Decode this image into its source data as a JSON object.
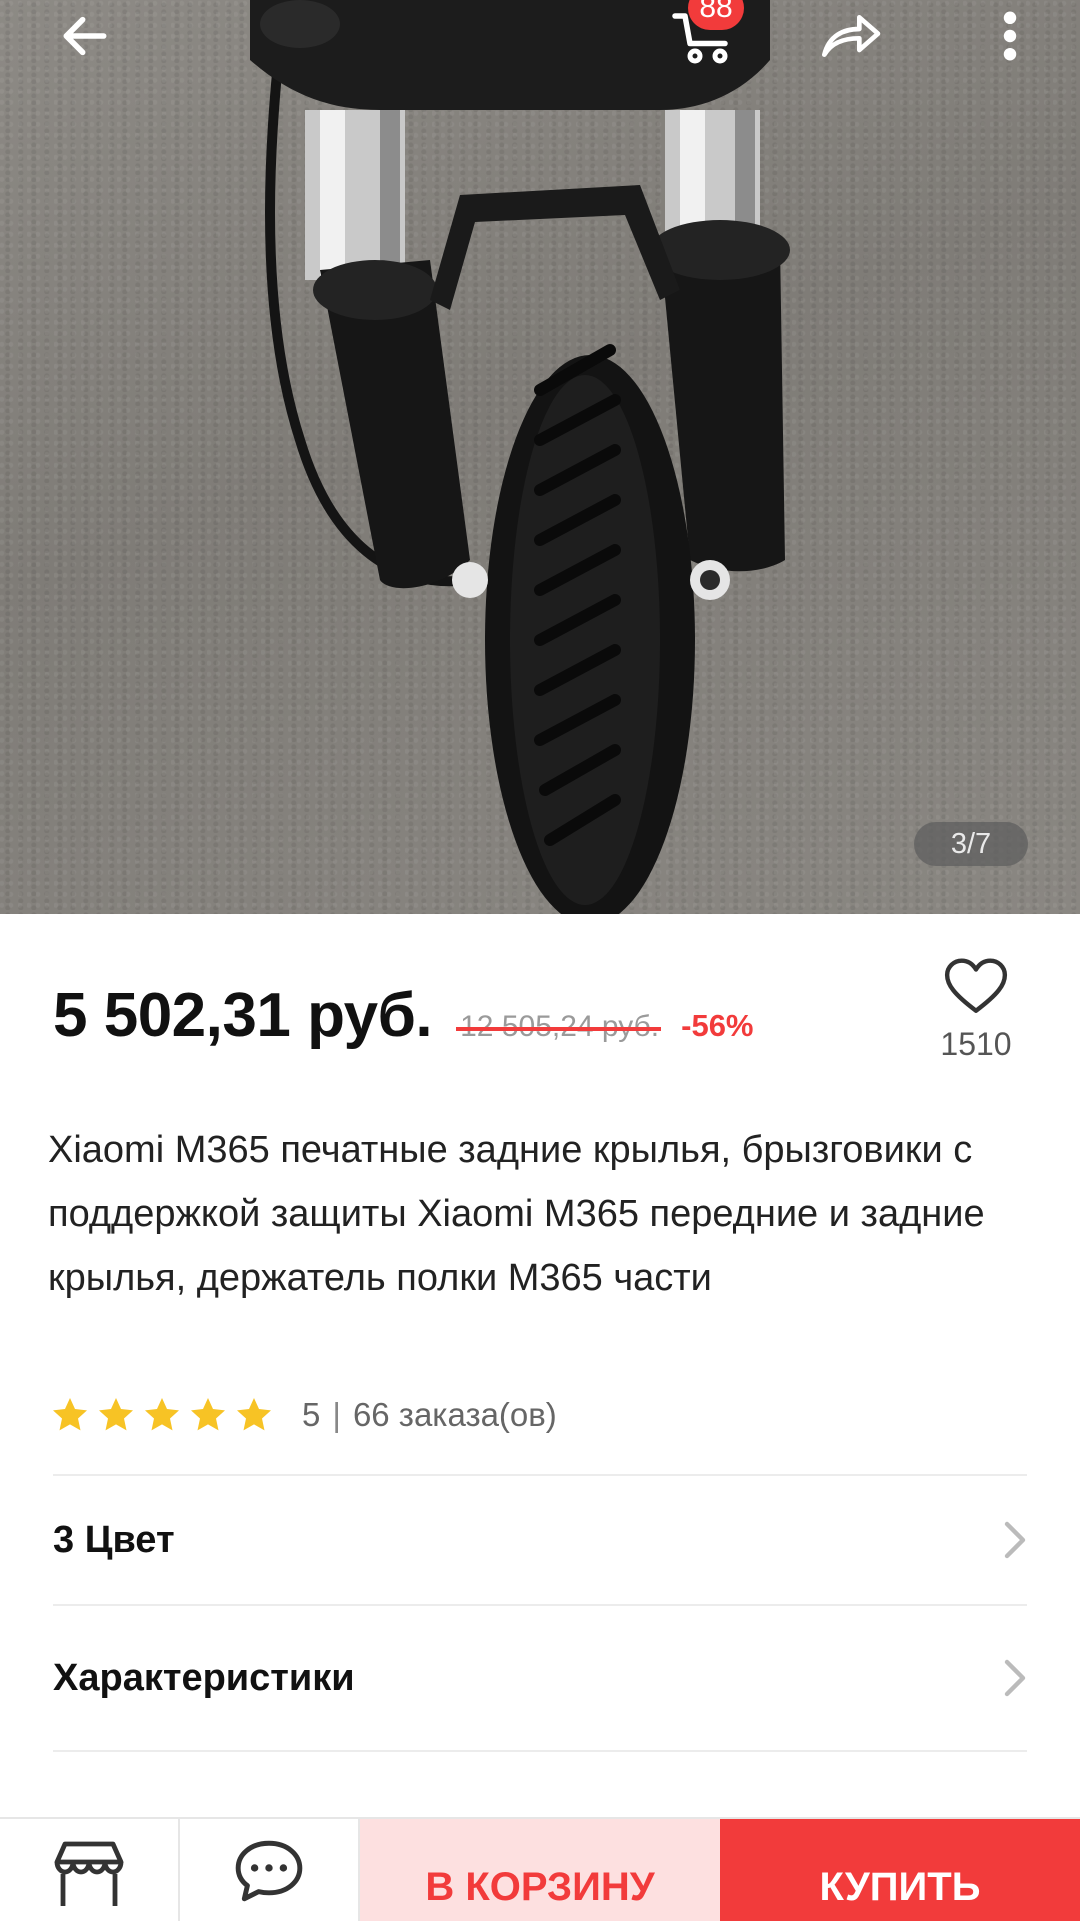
{
  "header": {
    "cart_badge": "88",
    "back_icon": "arrow-left-icon",
    "cart_icon": "cart-icon",
    "share_icon": "share-icon",
    "more_icon": "more-vertical-icon"
  },
  "gallery": {
    "counter": "3/7"
  },
  "product": {
    "price": "5 502,31 руб.",
    "old_price": "12 505,24 руб.",
    "discount": "-56%",
    "wish_count": "1510",
    "title": "Xiaomi M365 печатные задние крылья, брызговики с поддержкой защиты Xiaomi M365 передние и задние крылья, держатель полки M365 части",
    "rating": "5",
    "rating_separator": "|",
    "orders": "66 заказа(ов)",
    "rating_fraction": 1.0
  },
  "sections": {
    "color": "3 Цвет",
    "specs": "Характеристики"
  },
  "bottom_bar": {
    "add_to_cart": "В КОРЗИНУ",
    "buy": "КУПИТЬ"
  },
  "colors": {
    "accent": "#f23b3b",
    "accent_light": "#fde0e0",
    "star": "#f7c325"
  }
}
